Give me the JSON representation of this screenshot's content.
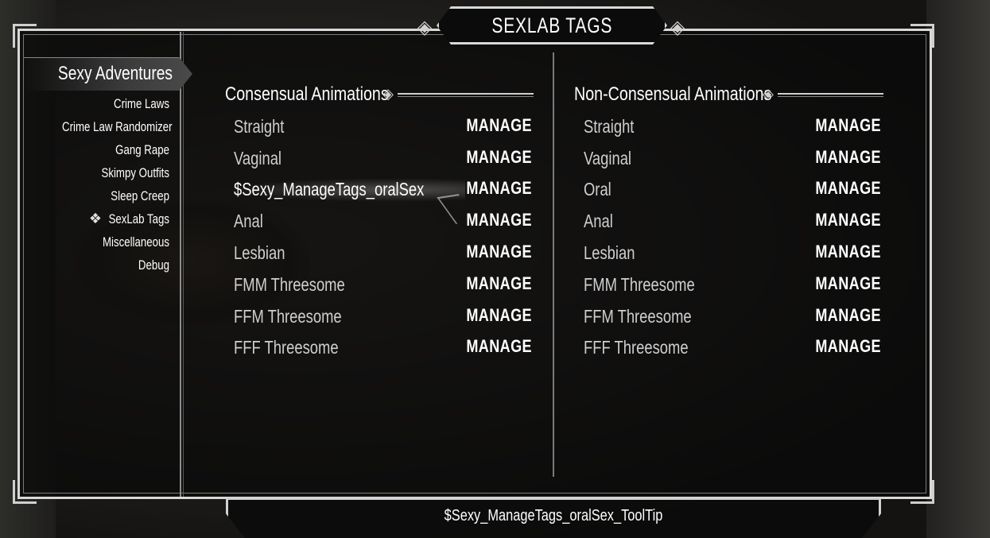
{
  "window": {
    "title": "SEXLAB TAGS"
  },
  "sidebar": {
    "active_label": "Sexy Adventures",
    "items": [
      {
        "label": "Crime Laws"
      },
      {
        "label": "Crime Law Randomizer"
      },
      {
        "label": "Gang Rape"
      },
      {
        "label": "Skimpy Outfits"
      },
      {
        "label": "Sleep Creep"
      },
      {
        "label": "SexLab Tags"
      },
      {
        "label": "Miscellaneous"
      },
      {
        "label": "Debug"
      }
    ],
    "selected_icon": "selected-ornament-icon"
  },
  "consensual": {
    "heading": "Consensual Animations",
    "rows": [
      {
        "label": "Straight",
        "action": "MANAGE"
      },
      {
        "label": "Vaginal",
        "action": "MANAGE"
      },
      {
        "label": "$Sexy_ManageTags_oralSex",
        "action": "MANAGE"
      },
      {
        "label": "Anal",
        "action": "MANAGE"
      },
      {
        "label": "Lesbian",
        "action": "MANAGE"
      },
      {
        "label": "FMM Threesome",
        "action": "MANAGE"
      },
      {
        "label": "FFM Threesome",
        "action": "MANAGE"
      },
      {
        "label": "FFF Threesome",
        "action": "MANAGE"
      }
    ]
  },
  "nonconsensual": {
    "heading": "Non-Consensual Animations",
    "rows": [
      {
        "label": "Straight",
        "action": "MANAGE"
      },
      {
        "label": "Vaginal",
        "action": "MANAGE"
      },
      {
        "label": "Oral",
        "action": "MANAGE"
      },
      {
        "label": "Anal",
        "action": "MANAGE"
      },
      {
        "label": "Lesbian",
        "action": "MANAGE"
      },
      {
        "label": "FMM Threesome",
        "action": "MANAGE"
      },
      {
        "label": "FFM Threesome",
        "action": "MANAGE"
      },
      {
        "label": "FFF Threesome",
        "action": "MANAGE"
      }
    ]
  },
  "footer": {
    "tooltip": "$Sexy_ManageTags_oralSex_ToolTip"
  }
}
